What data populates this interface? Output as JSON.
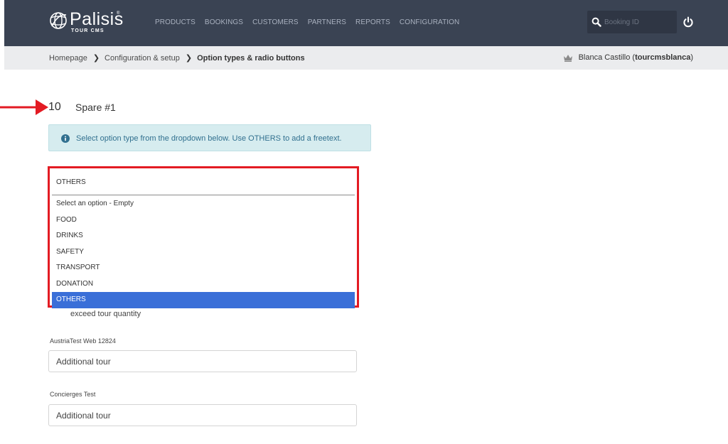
{
  "header": {
    "logo_text": "Palisis",
    "logo_trademark": "®",
    "logo_sub": "TOUR CMS",
    "nav": [
      "PRODUCTS",
      "BOOKINGS",
      "CUSTOMERS",
      "PARTNERS",
      "REPORTS",
      "CONFIGURATION"
    ],
    "search_placeholder": "Booking ID"
  },
  "breadcrumb": {
    "items": [
      "Homepage",
      "Configuration & setup",
      "Option types & radio buttons"
    ],
    "separator": "❯"
  },
  "user": {
    "name": "Blanca Castillo",
    "open_paren": "(",
    "handle": "tourcmsblanca",
    "close_paren": ")"
  },
  "section": {
    "number": "10",
    "title": "Spare #1"
  },
  "alert": {
    "text": "Select option type from the dropdown below. Use OTHERS to add a freetext."
  },
  "dropdown": {
    "selected_value": "OTHERS",
    "options": [
      "Select an option - Empty",
      "FOOD",
      "DRINKS",
      "SAFETY",
      "TRANSPORT",
      "DONATION",
      "OTHERS"
    ],
    "selected_index": 6
  },
  "partially_hidden_text": "exceed tour quantity",
  "fields": [
    {
      "label": "AustriaTest Web 12824",
      "value": "Additional tour"
    },
    {
      "label": "Concierges Test",
      "value": "Additional tour"
    }
  ],
  "colors": {
    "header_bg": "#3a4353",
    "crumb_bg": "#ebecee",
    "alert_bg": "#d6ecef",
    "highlight_red": "#e31b23",
    "selected_option": "#3a6fd8"
  }
}
